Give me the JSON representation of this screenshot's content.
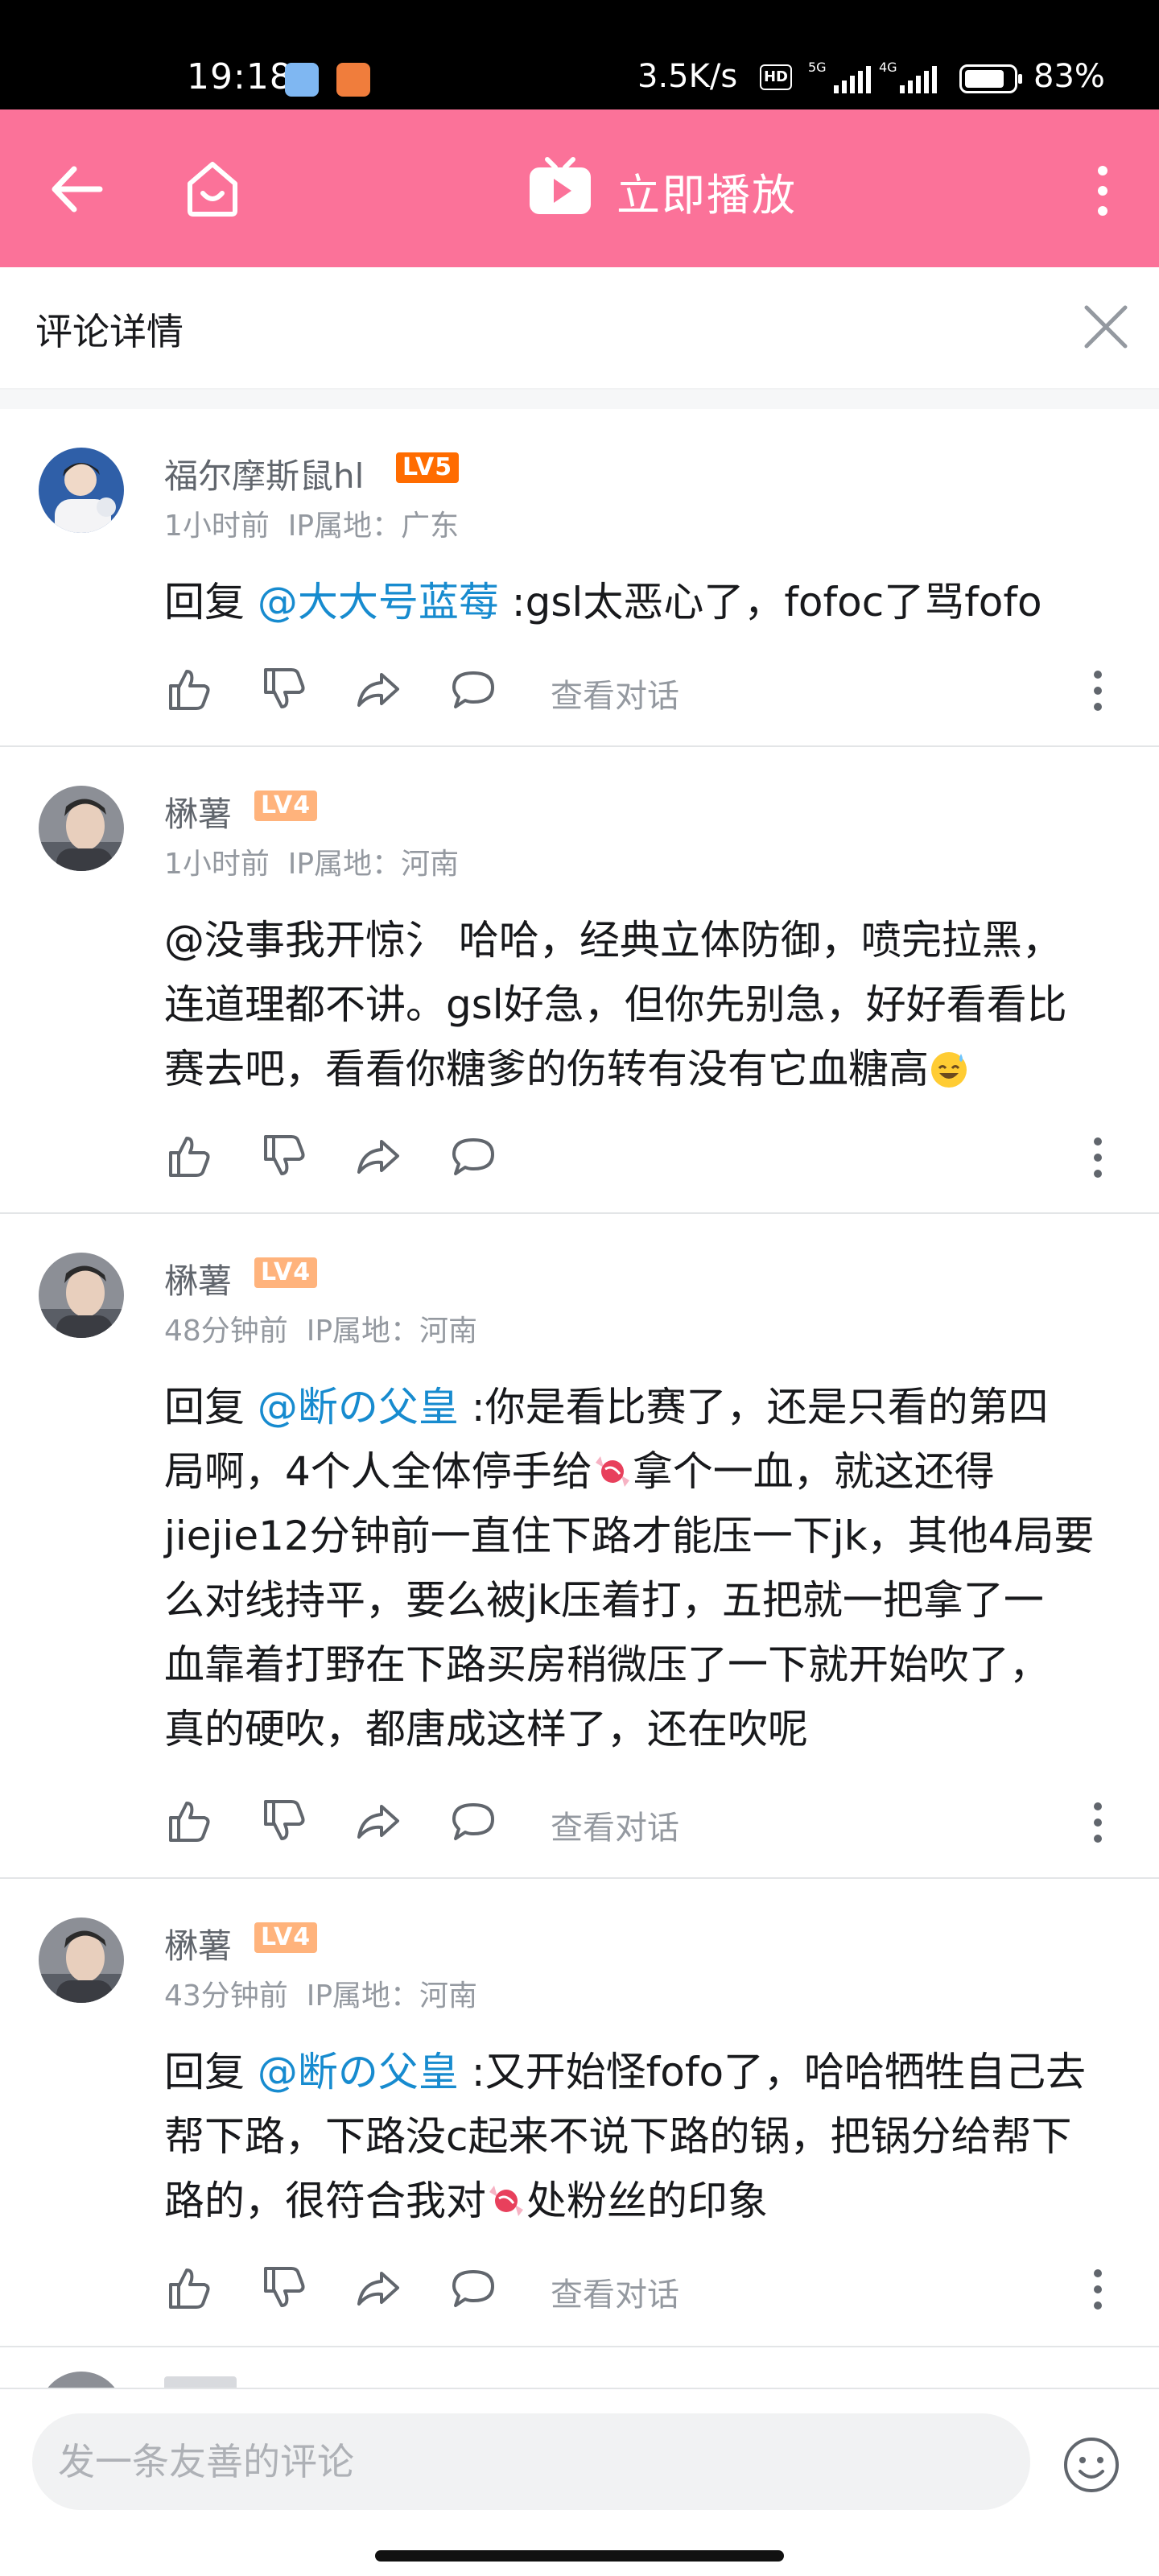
{
  "status_bar": {
    "time": "19:18",
    "speed": "3.5K/s",
    "hd_badge": "HD",
    "net_5g": "5G",
    "net_4g": "4G",
    "battery_percent_text": "83%",
    "battery_level": 0.83
  },
  "header": {
    "play_label": "立即播放"
  },
  "subheader": {
    "title": "评论详情"
  },
  "comments": [
    {
      "username": "福尔摩斯鼠hl",
      "level": "LV5",
      "time": "1小时前",
      "ip": "IP属地：广东",
      "reply_prefix": "回复 ",
      "reply_to": "@大大号蓝莓",
      "text": " :gsl太恶心了，fofoc了骂fofo",
      "view_thread": "查看对话"
    },
    {
      "username": "楙薯",
      "level": "LV4",
      "time": "1小时前",
      "ip": "IP属地：河南",
      "text_line1": "@没事我开惊氵 哈哈，经典立体防御，喷完拉黑，",
      "text_line2": "连道理都不讲。gsl好急，但你先别急，好好看看比",
      "text_line3": "赛去吧，看看你糖爹的伤转有没有它血糖高"
    },
    {
      "username": "楙薯",
      "level": "LV4",
      "time": "48分钟前",
      "ip": "IP属地：河南",
      "reply_prefix": "回复 ",
      "reply_to": "@断の父皇",
      "text_a": " :你是看比赛了，还是只看的第四",
      "text_b": "局啊，4个人全体停手给",
      "text_c": "拿个一血，就这还得",
      "text_d": "jiejie12分钟前一直住下路才能压一下jk，其他4局要",
      "text_e": "么对线持平，要么被jk压着打，五把就一把拿了一",
      "text_f": "血靠着打野在下路买房稍微压了一下就开始吹了，",
      "text_g": "真的硬吹，都唐成这样了，还在吹呢",
      "view_thread": "查看对话"
    },
    {
      "username": "楙薯",
      "level": "LV4",
      "time": "43分钟前",
      "ip": "IP属地：河南",
      "reply_prefix": "回复 ",
      "reply_to": "@断の父皇",
      "text_a": " :又开始怪fofo了，哈哈牺牲自己去",
      "text_b": "帮下路，下路没c起来不说下路的锅，把锅分给帮下",
      "text_c": "路的，很符合我对",
      "text_d": "处粉丝的印象",
      "view_thread": "查看对话"
    }
  ],
  "bottom_bar": {
    "input_placeholder": "发一条友善的评论"
  },
  "colors": {
    "brand_pink": "#fb7299",
    "link_blue": "#178bcf",
    "lv5_orange": "#ff6c00",
    "lv4_orange": "#ffb37c"
  },
  "icons": [
    "back-arrow-icon",
    "home-icon",
    "tv-play-icon",
    "more-vertical-icon",
    "close-icon",
    "thumbs-up-icon",
    "thumbs-down-icon",
    "share-icon",
    "comment-bubble-icon",
    "candy-emoji-icon",
    "sweat-smile-emoji-icon",
    "emoji-face-icon"
  ]
}
